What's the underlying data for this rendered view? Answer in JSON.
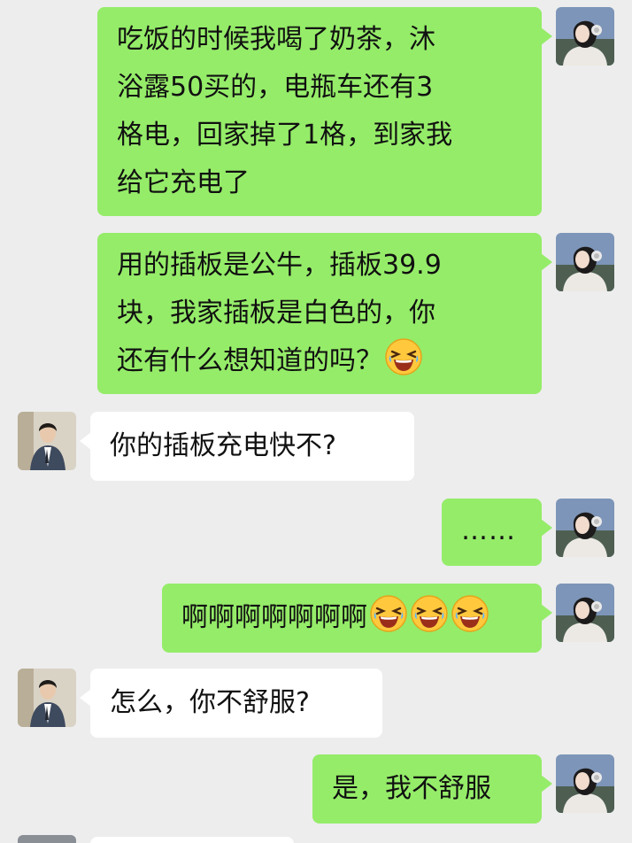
{
  "messages": [
    {
      "from": "me",
      "lines": [
        "吃饭的时候我喝了奶茶，沐",
        "浴露50买的，电瓶车还有3",
        "格电，回家掉了1格，到家我",
        "给它充电了"
      ]
    },
    {
      "from": "me",
      "lines": [
        "用的插板是公牛，插板39.9",
        "块，我家插板是白色的，你",
        "还有什么想知道的吗？"
      ],
      "emoji": [
        "laughing-emoji"
      ]
    },
    {
      "from": "them",
      "lines": [
        "你的插板充电快不?"
      ]
    },
    {
      "from": "me",
      "lines": [
        "……"
      ]
    },
    {
      "from": "me",
      "lines": [
        "啊啊啊啊啊啊啊"
      ],
      "emoji": [
        "laughing-emoji",
        "laughing-emoji",
        "laughing-emoji"
      ]
    },
    {
      "from": "them",
      "lines": [
        "怎么，你不舒服?"
      ]
    },
    {
      "from": "me",
      "lines": [
        "是，我不舒服"
      ]
    }
  ],
  "colors": {
    "background": "#ededed",
    "outgoing_bubble": "#95ec69",
    "incoming_bubble": "#ffffff",
    "text": "#111111"
  },
  "icons": {
    "my_avatar": "girl-with-headphones-avatar",
    "their_avatar": "man-in-suit-avatar",
    "emoji": "laughing-emoji"
  }
}
